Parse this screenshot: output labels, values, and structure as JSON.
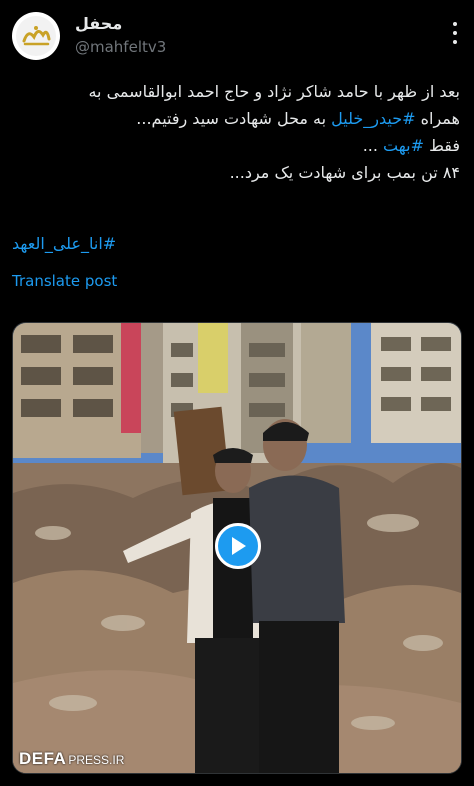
{
  "author": {
    "display_name": "محفل",
    "handle": "@mahfeltv3",
    "avatar_icon": "mahfel-logo-icon"
  },
  "menu": {
    "icon": "more-options-icon"
  },
  "post": {
    "line1": "بعد از ظهر با حامد شاکر نژاد و حاج احمد ابوالقاسمی به",
    "line2_prefix": "همراه ",
    "line2_tag": "#حیدر_خلیل",
    "line2_suffix": " به محل شهادت سید رفتیم...",
    "line3_prefix": "فقط ",
    "line3_tag": "#بهت",
    "line3_suffix": " ...",
    "line4": "۸۴ تن بمب برای شهادت یک مرد...",
    "hashtag": "#انا_علی_العهد",
    "translate_label": "Translate post"
  },
  "media": {
    "play_icon": "play-icon",
    "watermark_brand": "DEFA",
    "watermark_sub": "PRESS.IR"
  },
  "colors": {
    "background": "#000000",
    "text": "#e7e9ea",
    "secondary": "#71767b",
    "accent": "#1d9bf0"
  }
}
